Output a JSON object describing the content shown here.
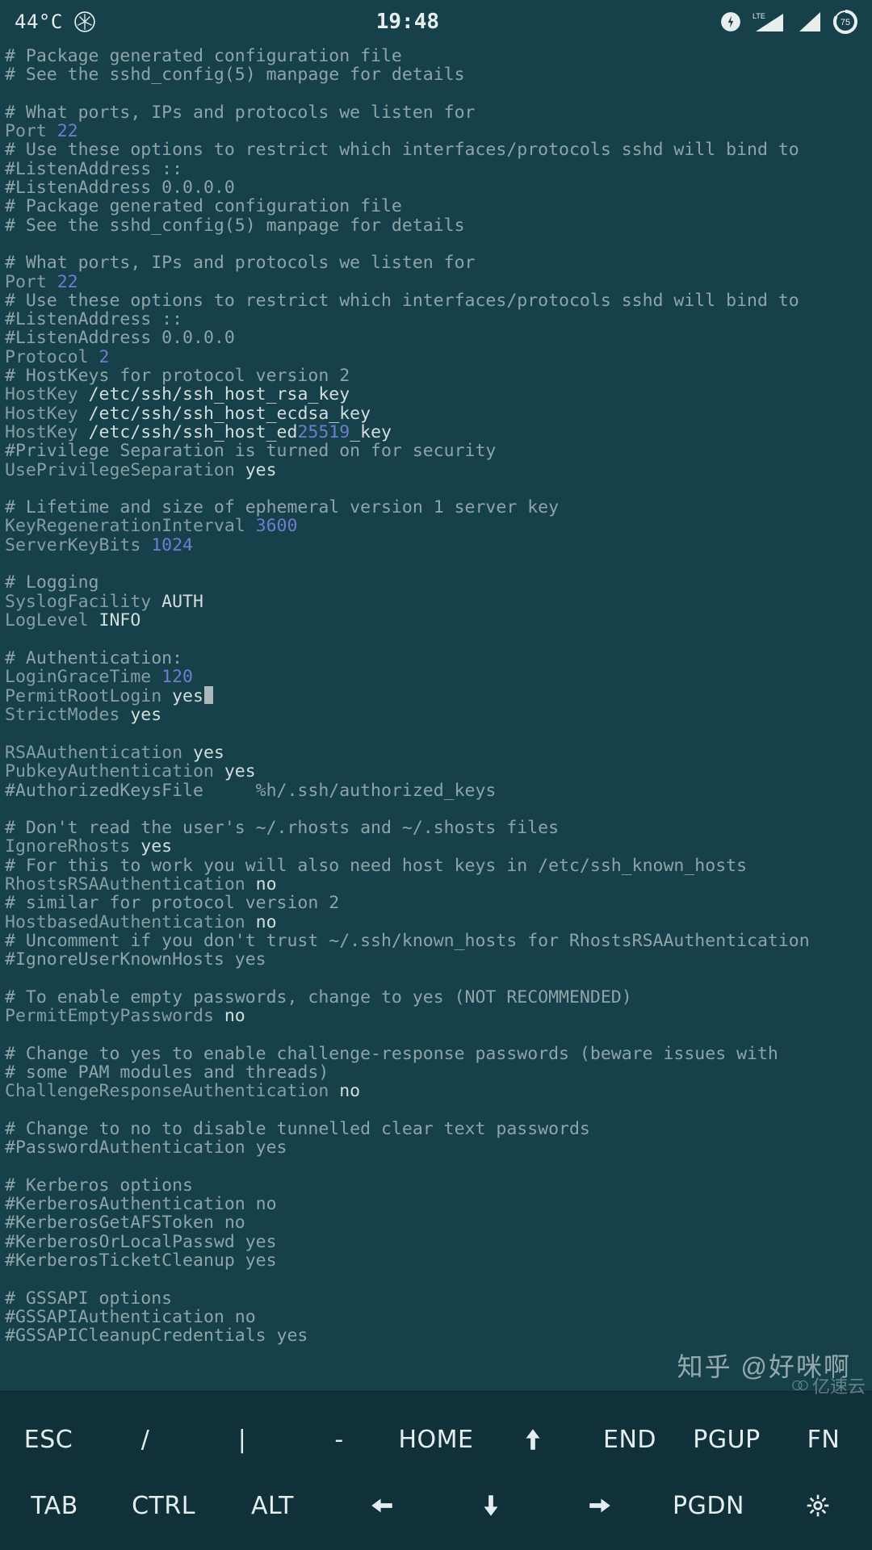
{
  "status": {
    "temperature": "44°C",
    "clock": "19:48",
    "network_label": "LTE",
    "battery_percent": "75"
  },
  "terminal": {
    "lines": [
      {
        "cls": "c-comment",
        "text": "# Package generated configuration file"
      },
      {
        "cls": "c-comment",
        "text": "# See the sshd_config(5) manpage for details"
      },
      {
        "cls": "c-empty",
        "text": ""
      },
      {
        "cls": "c-comment",
        "text": "# What ports, IPs and protocols we listen for"
      },
      {
        "spans": [
          {
            "cls": "c-key",
            "text": "Port "
          },
          {
            "cls": "c-num",
            "text": "22"
          }
        ]
      },
      {
        "cls": "c-comment",
        "text": "# Use these options to restrict which interfaces/protocols sshd will bind to"
      },
      {
        "cls": "c-comment",
        "text": "#ListenAddress ::"
      },
      {
        "cls": "c-comment",
        "text": "#ListenAddress 0.0.0.0"
      },
      {
        "cls": "c-comment",
        "text": "# Package generated configuration file"
      },
      {
        "cls": "c-comment",
        "text": "# See the sshd_config(5) manpage for details"
      },
      {
        "cls": "c-empty",
        "text": ""
      },
      {
        "cls": "c-comment",
        "text": "# What ports, IPs and protocols we listen for"
      },
      {
        "spans": [
          {
            "cls": "c-key",
            "text": "Port "
          },
          {
            "cls": "c-num",
            "text": "22"
          }
        ]
      },
      {
        "cls": "c-comment",
        "text": "# Use these options to restrict which interfaces/protocols sshd will bind to"
      },
      {
        "cls": "c-comment",
        "text": "#ListenAddress ::"
      },
      {
        "cls": "c-comment",
        "text": "#ListenAddress 0.0.0.0"
      },
      {
        "spans": [
          {
            "cls": "c-key",
            "text": "Protocol "
          },
          {
            "cls": "c-num",
            "text": "2"
          }
        ]
      },
      {
        "cls": "c-comment",
        "text": "# HostKeys for protocol version 2"
      },
      {
        "spans": [
          {
            "cls": "c-key",
            "text": "HostKey "
          },
          {
            "cls": "c-path",
            "text": "/etc/ssh/ssh_host_rsa_key"
          }
        ]
      },
      {
        "spans": [
          {
            "cls": "c-key",
            "text": "HostKey "
          },
          {
            "cls": "c-path",
            "text": "/etc/ssh/ssh_host_ecdsa_key"
          }
        ]
      },
      {
        "spans": [
          {
            "cls": "c-key",
            "text": "HostKey "
          },
          {
            "cls": "c-path",
            "text": "/etc/ssh/ssh_host_ed"
          },
          {
            "cls": "c-num",
            "text": "25519"
          },
          {
            "cls": "c-path",
            "text": "_key"
          }
        ]
      },
      {
        "cls": "c-comment",
        "text": "#Privilege Separation is turned on for security"
      },
      {
        "spans": [
          {
            "cls": "c-key",
            "text": "UsePrivilegeSeparation "
          },
          {
            "cls": "c-val",
            "text": "yes"
          }
        ]
      },
      {
        "cls": "c-empty",
        "text": ""
      },
      {
        "cls": "c-comment",
        "text": "# Lifetime and size of ephemeral version 1 server key"
      },
      {
        "spans": [
          {
            "cls": "c-key",
            "text": "KeyRegenerationInterval "
          },
          {
            "cls": "c-num",
            "text": "3600"
          }
        ]
      },
      {
        "spans": [
          {
            "cls": "c-key",
            "text": "ServerKeyBits "
          },
          {
            "cls": "c-num",
            "text": "1024"
          }
        ]
      },
      {
        "cls": "c-empty",
        "text": ""
      },
      {
        "cls": "c-comment",
        "text": "# Logging"
      },
      {
        "spans": [
          {
            "cls": "c-key",
            "text": "SyslogFacility "
          },
          {
            "cls": "c-val",
            "text": "AUTH"
          }
        ]
      },
      {
        "spans": [
          {
            "cls": "c-key",
            "text": "LogLevel "
          },
          {
            "cls": "c-val",
            "text": "INFO"
          }
        ]
      },
      {
        "cls": "c-empty",
        "text": ""
      },
      {
        "cls": "c-comment",
        "text": "# Authentication:"
      },
      {
        "spans": [
          {
            "cls": "c-key",
            "text": "LoginGraceTime "
          },
          {
            "cls": "c-num",
            "text": "120"
          }
        ]
      },
      {
        "spans": [
          {
            "cls": "c-key",
            "text": "PermitRootLogin "
          },
          {
            "cls": "c-val",
            "text": "yes"
          },
          {
            "cursor": true
          }
        ]
      },
      {
        "spans": [
          {
            "cls": "c-key",
            "text": "StrictModes "
          },
          {
            "cls": "c-val",
            "text": "yes"
          }
        ]
      },
      {
        "cls": "c-empty",
        "text": ""
      },
      {
        "spans": [
          {
            "cls": "c-key",
            "text": "RSAAuthentication "
          },
          {
            "cls": "c-val",
            "text": "yes"
          }
        ]
      },
      {
        "spans": [
          {
            "cls": "c-key",
            "text": "PubkeyAuthentication "
          },
          {
            "cls": "c-val",
            "text": "yes"
          }
        ]
      },
      {
        "cls": "c-comment",
        "text": "#AuthorizedKeysFile     %h/.ssh/authorized_keys"
      },
      {
        "cls": "c-empty",
        "text": ""
      },
      {
        "cls": "c-comment",
        "text": "# Don't read the user's ~/.rhosts and ~/.shosts files"
      },
      {
        "spans": [
          {
            "cls": "c-key",
            "text": "IgnoreRhosts "
          },
          {
            "cls": "c-val",
            "text": "yes"
          }
        ]
      },
      {
        "cls": "c-comment",
        "text": "# For this to work you will also need host keys in /etc/ssh_known_hosts"
      },
      {
        "spans": [
          {
            "cls": "c-key",
            "text": "RhostsRSAAuthentication "
          },
          {
            "cls": "c-val",
            "text": "no"
          }
        ]
      },
      {
        "cls": "c-comment",
        "text": "# similar for protocol version 2"
      },
      {
        "spans": [
          {
            "cls": "c-key",
            "text": "HostbasedAuthentication "
          },
          {
            "cls": "c-val",
            "text": "no"
          }
        ]
      },
      {
        "cls": "c-comment",
        "text": "# Uncomment if you don't trust ~/.ssh/known_hosts for RhostsRSAAuthentication"
      },
      {
        "cls": "c-comment",
        "text": "#IgnoreUserKnownHosts yes"
      },
      {
        "cls": "c-empty",
        "text": ""
      },
      {
        "cls": "c-comment",
        "text": "# To enable empty passwords, change to yes (NOT RECOMMENDED)"
      },
      {
        "spans": [
          {
            "cls": "c-key",
            "text": "PermitEmptyPasswords "
          },
          {
            "cls": "c-val",
            "text": "no"
          }
        ]
      },
      {
        "cls": "c-empty",
        "text": ""
      },
      {
        "cls": "c-comment",
        "text": "# Change to yes to enable challenge-response passwords (beware issues with"
      },
      {
        "cls": "c-comment",
        "text": "# some PAM modules and threads)"
      },
      {
        "spans": [
          {
            "cls": "c-key",
            "text": "ChallengeResponseAuthentication "
          },
          {
            "cls": "c-val",
            "text": "no"
          }
        ]
      },
      {
        "cls": "c-empty",
        "text": ""
      },
      {
        "cls": "c-comment",
        "text": "# Change to no to disable tunnelled clear text passwords"
      },
      {
        "cls": "c-comment",
        "text": "#PasswordAuthentication yes"
      },
      {
        "cls": "c-empty",
        "text": ""
      },
      {
        "cls": "c-comment",
        "text": "# Kerberos options"
      },
      {
        "cls": "c-comment",
        "text": "#KerberosAuthentication no"
      },
      {
        "cls": "c-comment",
        "text": "#KerberosGetAFSToken no"
      },
      {
        "cls": "c-comment",
        "text": "#KerberosOrLocalPasswd yes"
      },
      {
        "cls": "c-comment",
        "text": "#KerberosTicketCleanup yes"
      },
      {
        "cls": "c-empty",
        "text": ""
      },
      {
        "cls": "c-comment",
        "text": "# GSSAPI options"
      },
      {
        "cls": "c-comment",
        "text": "#GSSAPIAuthentication no"
      },
      {
        "cls": "c-comment",
        "text": "#GSSAPICleanupCredentials yes"
      }
    ]
  },
  "keyboard": {
    "row1": [
      "ESC",
      "/",
      "|",
      "-",
      "HOME",
      "↑",
      "END",
      "PGUP",
      "FN"
    ],
    "row2": [
      "TAB",
      "CTRL",
      "ALT",
      "←",
      "↓",
      "→",
      "PGDN",
      "⚙"
    ]
  },
  "watermarks": {
    "zhihu": "知乎 @好咪啊",
    "yisu": "亿速云"
  }
}
